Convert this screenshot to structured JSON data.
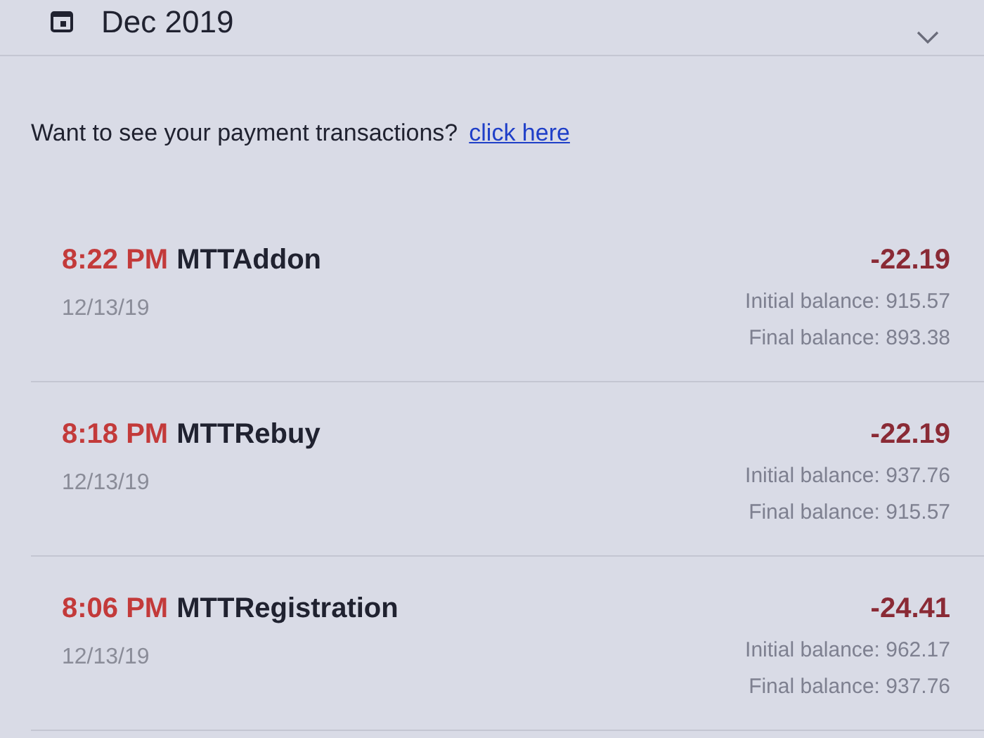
{
  "month_picker": {
    "label": "Dec 2019",
    "expanded": false
  },
  "notice": {
    "text": "Want to see your payment transactions?",
    "link": "click here"
  },
  "transactions": [
    {
      "time": "8:22 PM",
      "name": "MTTAddon",
      "date": "12/13/19",
      "amount": "-22.19",
      "initial": "Initial balance: 915.57",
      "final": "Final balance: 893.38"
    },
    {
      "time": "8:18 PM",
      "name": "MTTRebuy",
      "date": "12/13/19",
      "amount": "-22.19",
      "initial": "Initial balance: 937.76",
      "final": "Final balance: 915.57"
    },
    {
      "time": "8:06 PM",
      "name": "MTTRegistration",
      "date": "12/13/19",
      "amount": "-24.41",
      "initial": "Initial balance: 962.17",
      "final": "Final balance: 937.76"
    }
  ]
}
